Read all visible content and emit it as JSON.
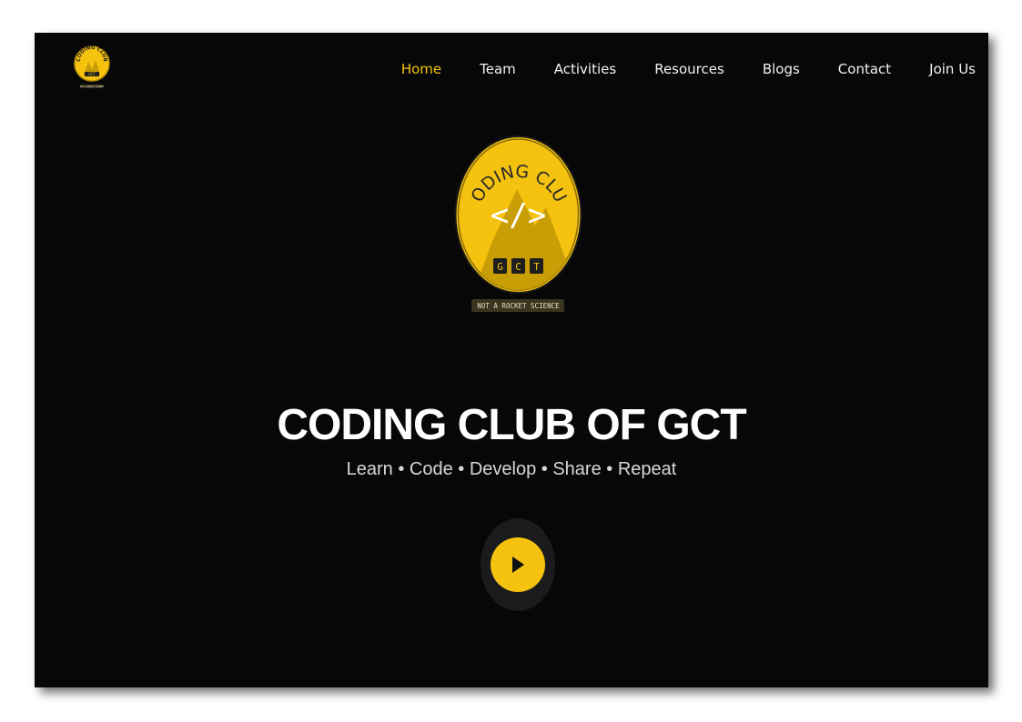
{
  "nav": {
    "items": [
      {
        "label": "Home",
        "active": true
      },
      {
        "label": "Team",
        "active": false
      },
      {
        "label": "Activities",
        "active": false
      },
      {
        "label": "Resources",
        "active": false
      },
      {
        "label": "Blogs",
        "active": false
      },
      {
        "label": "Contact",
        "active": false
      },
      {
        "label": "Join Us",
        "active": false
      }
    ]
  },
  "logo": {
    "ring_text": "CODING CLUB",
    "code_symbol": "</>",
    "letters": [
      "G",
      "C",
      "T"
    ],
    "ribbon": "NOT A ROCKET SCIENCE"
  },
  "hero": {
    "title": "CODING CLUB OF GCT",
    "tagline": "Learn • Code • Develop • Share • Repeat"
  },
  "colors": {
    "background": "#070707",
    "accent": "#f5c20f",
    "accent_dark": "#c99d06",
    "text": "#ffffff"
  },
  "icons": {
    "play": "play-triangle-icon"
  }
}
